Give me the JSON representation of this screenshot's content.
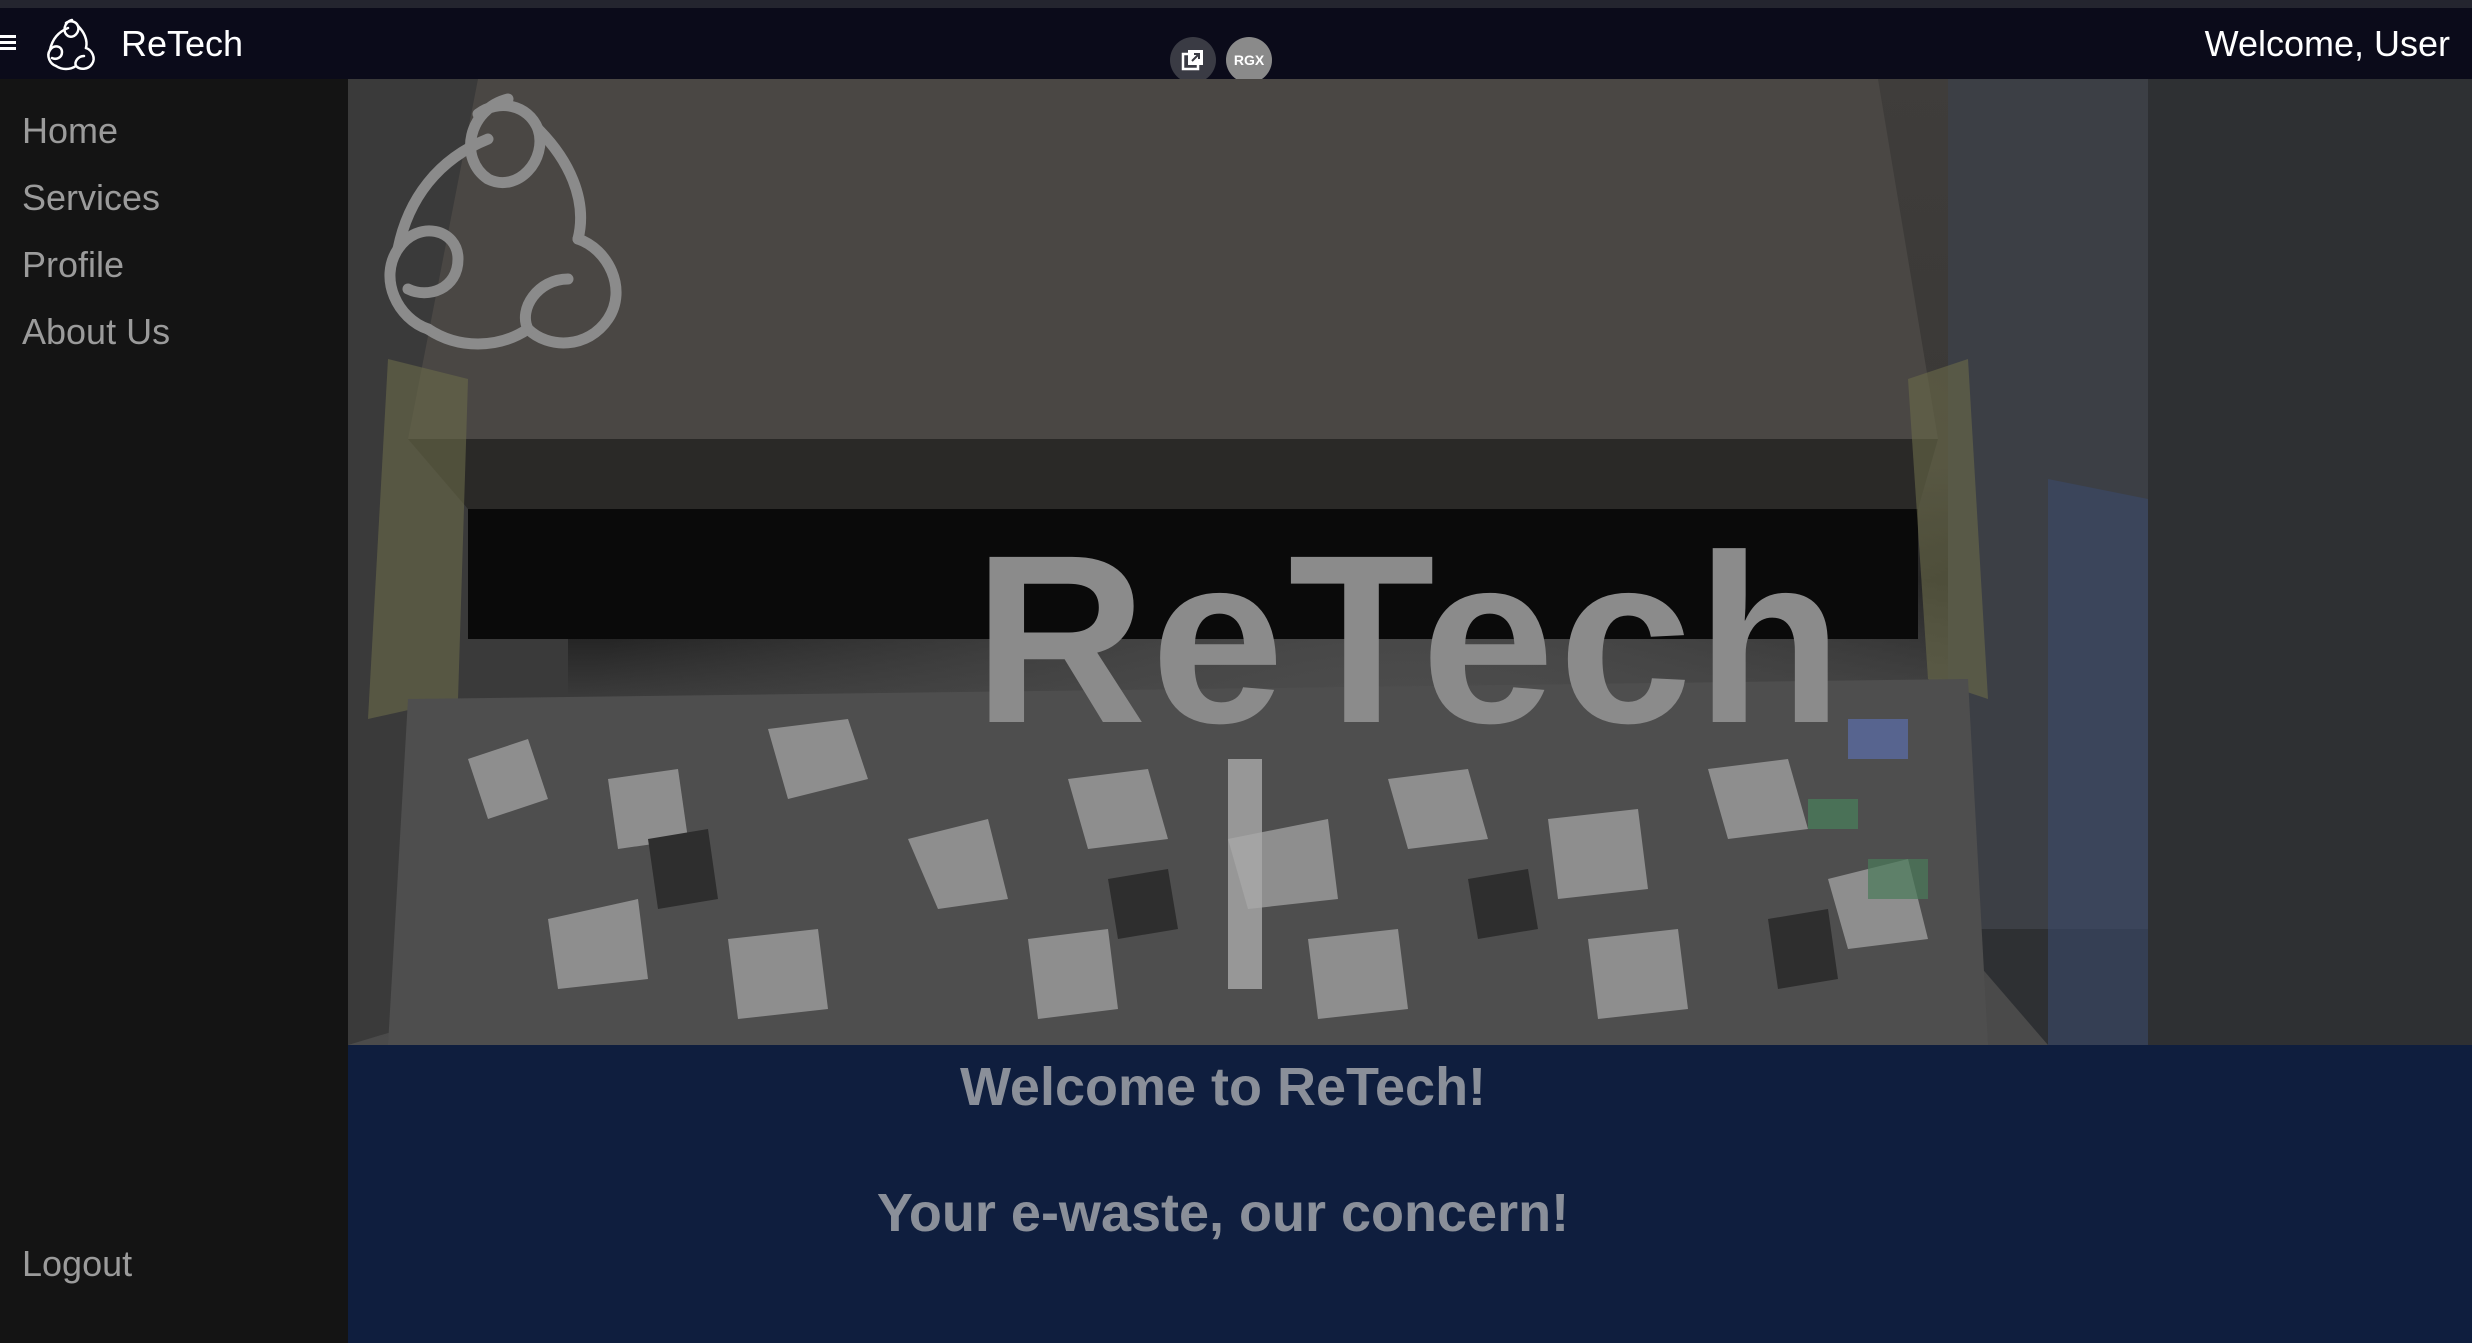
{
  "header": {
    "brand": "ReTech",
    "greeting": "Welcome, User",
    "extension_badge": "RGX"
  },
  "sidebar": {
    "items": [
      {
        "label": "Home"
      },
      {
        "label": "Services"
      },
      {
        "label": "Profile"
      },
      {
        "label": "About Us"
      }
    ],
    "logout": "Logout"
  },
  "hero": {
    "title": "ReTech"
  },
  "welcome": {
    "line1": "Welcome to ReTech!",
    "line2": "Your e-waste, our concern!"
  },
  "colors": {
    "topbar": "#0b0b1a",
    "sidebar": "#141414",
    "welcome_panel": "#0f1e3e",
    "nav_text": "#9b9b9b"
  },
  "icons": [
    "menu-icon",
    "recycle-logo-icon",
    "popout-icon",
    "rgx-extension-icon"
  ]
}
